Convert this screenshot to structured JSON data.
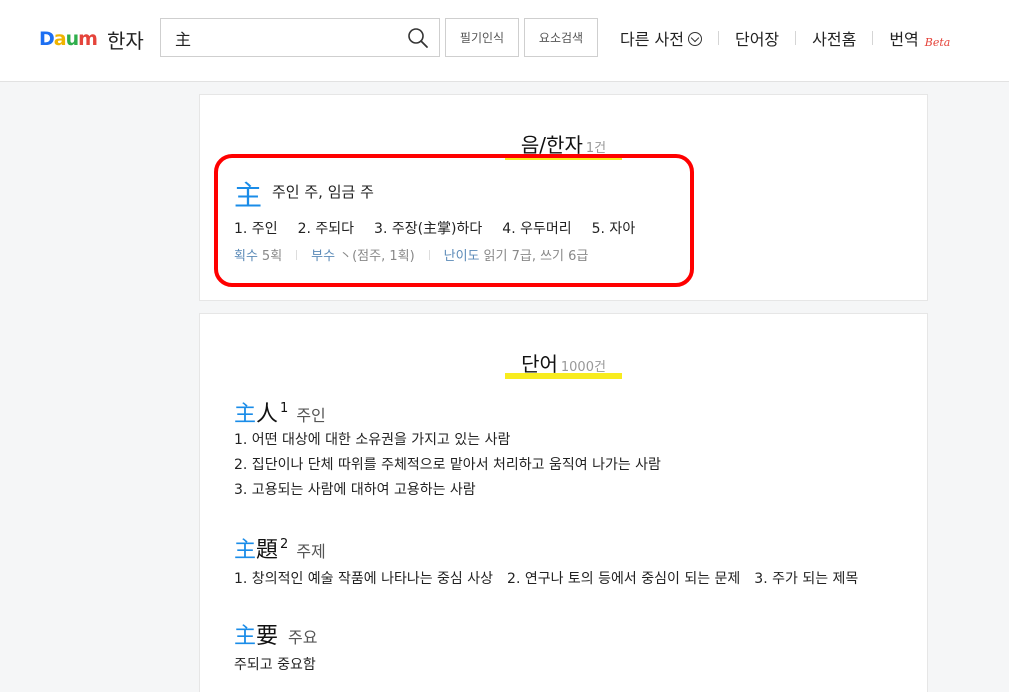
{
  "header": {
    "logo": {
      "d": "D",
      "a": "a",
      "u": "u",
      "m": "m",
      "service": "한자"
    },
    "search": {
      "value": "主",
      "icon": "search-icon"
    },
    "buttons": {
      "handwriting": "필기인식",
      "element_search": "요소검색"
    },
    "nav": {
      "other_dict": "다른 사전",
      "wordbook": "단어장",
      "dict_home": "사전홈",
      "translate": "번역",
      "beta": "Beta"
    }
  },
  "hanja_section": {
    "title": "음/한자",
    "count": "1건",
    "entry": {
      "char": "主",
      "meaning": "주인 주, 임금 주",
      "meanings": [
        "1. 주인",
        "2. 주되다",
        "3. 주장(主掌)하다",
        "4. 우두머리",
        "5. 자아"
      ],
      "strokes_label": "획수",
      "strokes_value": "5획",
      "radical_label": "부수",
      "radical_value": "丶(점주, 1획)",
      "level_label": "난이도",
      "level_value": "읽기 7급, 쓰기 6급"
    }
  },
  "word_section": {
    "title": "단어",
    "count": "1000건",
    "words": [
      {
        "char1": "主",
        "char2": "人",
        "sup": "1",
        "reading": "주인",
        "defs": [
          "1. 어떤 대상에 대한 소유권을 가지고 있는 사람",
          "2. 집단이나 단체 따위를 주체적으로 맡아서 처리하고 움직여 나가는 사람",
          "3. 고용되는 사람에 대하여 고용하는 사람"
        ]
      },
      {
        "char1": "主",
        "char2": "題",
        "sup": "2",
        "reading": "주제",
        "defs": [
          "1. 창의적인 예술 작품에 나타나는 중심 사상",
          "2. 연구나 토의 등에서 중심이 되는 문제",
          "3. 주가 되는 제목"
        ]
      },
      {
        "char1": "主",
        "char2": "要",
        "sup": "",
        "reading": "주요",
        "defs": [
          "주되고 중요함"
        ]
      }
    ]
  },
  "colors": {
    "accent_blue": "#1a8ce8",
    "highlight_yellow": "#f8ec1f",
    "annotation_red": "#ff0000",
    "beta_red": "#e5443b"
  }
}
